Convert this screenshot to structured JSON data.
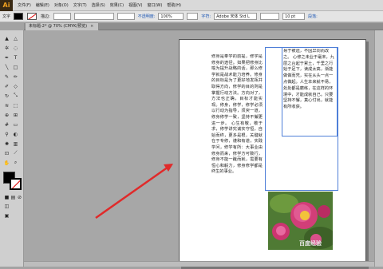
{
  "app": {
    "logo": "Ai"
  },
  "menu": [
    "文件(F)",
    "编辑(E)",
    "对象(O)",
    "文字(T)",
    "选择(S)",
    "效果(C)",
    "视图(V)",
    "窗口(W)",
    "帮助(H)"
  ],
  "options": {
    "tool_label": "文字",
    "stroke_label": "描边:",
    "opacity_label": "不透明度:",
    "opacity_value": "100%",
    "char_label": "字符:",
    "font_name": "Adobe 宋体 Std L",
    "font_size": "10 pt",
    "paragraph_label": "段落:"
  },
  "document_tab": {
    "title": "未标题-2* @ 70% (CMYK/预览)",
    "close": "×"
  },
  "page_text": {
    "column1": "修身是奉学的前提，修学是修身的途径。如果把修身比喻为提升战略的话，那么修学就是战术能力培养。修身的目标是为了更好地发挥并取得方向，修学的目的则是掌握行动方法。方向对了，方法也正确，目标才能实现。修身，修学，修学必须以行动为指导，须臾一道，修身修学一致，坚持不懈更进一步。\n心生有敬，敬于求，修学讲究诚实守恒，自始而终，更多是根，关键就在于专修，谨和有道，实践学问，修学有所：大事业由修身而来，修学方可致行，修身不能一蹴而就，需要有恒心和毅力，修身修学都是终生的事业。",
    "column2": "易于被遗，不因异同而改之。\n 心修之未业于毫末，九层之台起于累土，千里之行始于足下，读成太高，渐能做做而凭，实在从头一点一点做起。人生本来就不易，处处都是磨练，在这样的环境中，才能成就自己。只要坚持不懈，真心付出，就能有所收获。"
  },
  "watermark": "百度经验"
}
